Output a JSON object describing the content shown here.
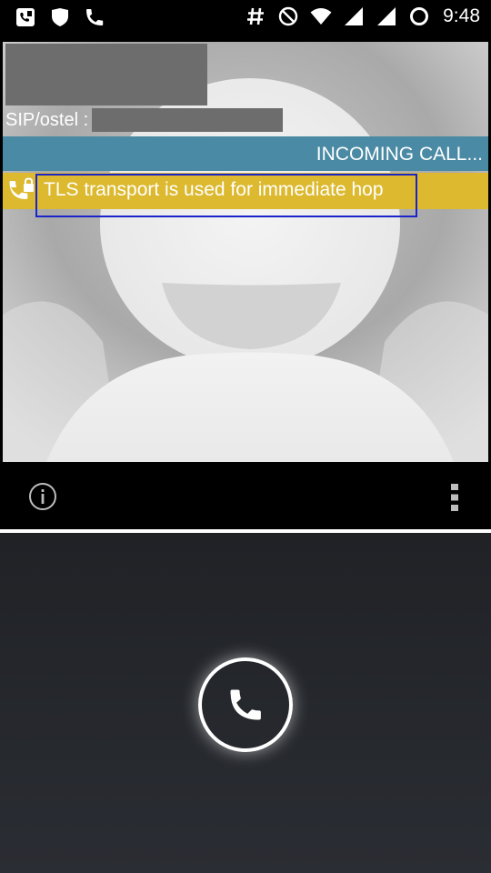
{
  "status_bar": {
    "time": "9:48",
    "left_icons": [
      "voicemail-icon",
      "shield-icon",
      "phone-icon"
    ],
    "right_icons": [
      "hash-icon",
      "do-not-disturb-icon",
      "wifi-icon",
      "cell-signal-icon",
      "cell-signal-2-icon",
      "battery-ring-icon"
    ]
  },
  "call": {
    "sip_label": "SIP/ostel :",
    "status_text": "INCOMING CALL...",
    "tls_message": "TLS transport is used for immediate hop",
    "colors": {
      "status_bar_bg": "#4a8aa4",
      "tls_bar_bg": "#dcb92e",
      "highlight_outline": "#1a24c8"
    }
  },
  "actions": {
    "info_icon": "info-icon",
    "menu_icon": "overflow-menu-icon"
  },
  "answer": {
    "icon": "phone-icon"
  }
}
